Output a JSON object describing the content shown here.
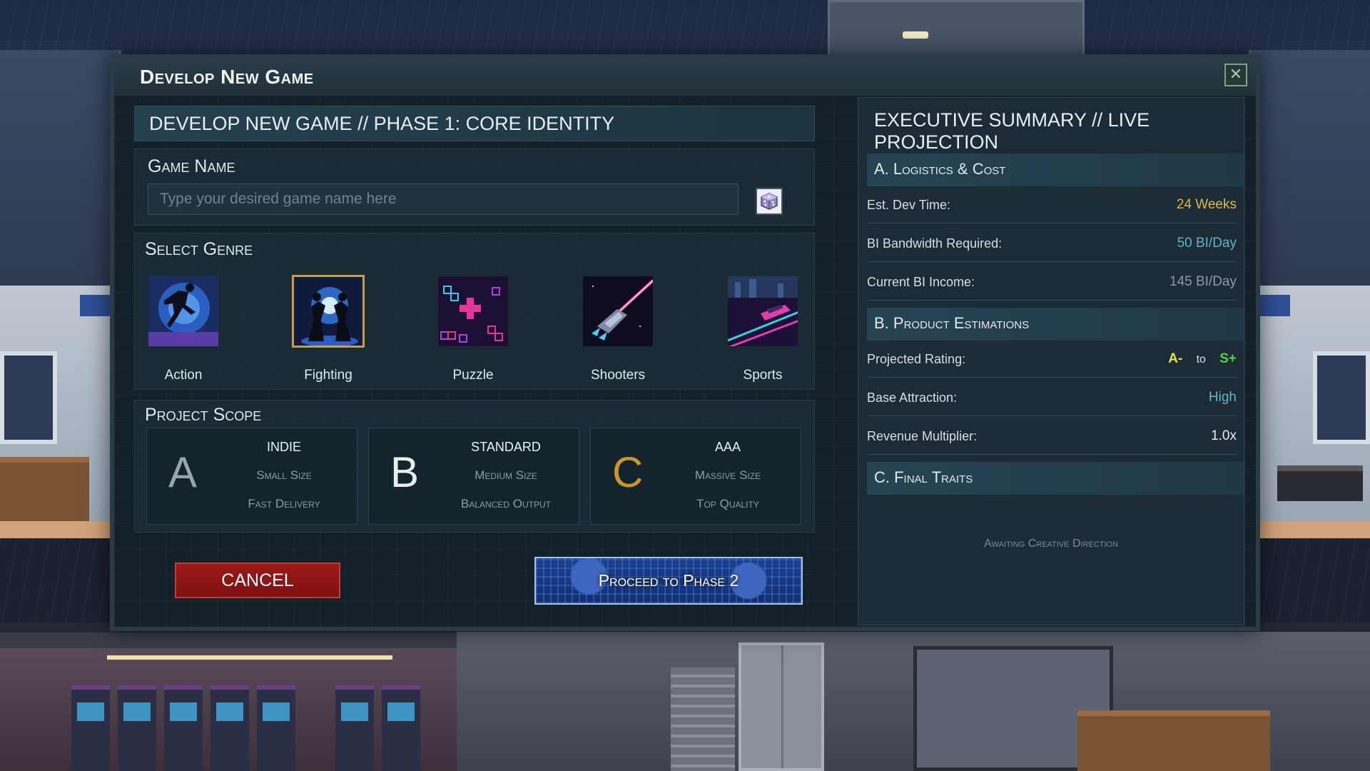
{
  "dialog": {
    "title": "Develop New Game",
    "close_icon": "close-icon"
  },
  "phase_header": "DEVELOP NEW GAME // PHASE 1: CORE IDENTITY",
  "game_name": {
    "label": "Game Name",
    "placeholder": "Type your desired game name here",
    "value": "",
    "random_icon": "dice-icon"
  },
  "genre": {
    "label": "Select Genre",
    "selected": "Fighting",
    "items": [
      {
        "label": "Action",
        "icon": "action-genre-art"
      },
      {
        "label": "Fighting",
        "icon": "fighting-genre-art"
      },
      {
        "label": "Puzzle",
        "icon": "puzzle-genre-art"
      },
      {
        "label": "Shooters",
        "icon": "shooters-genre-art"
      },
      {
        "label": "Sports",
        "icon": "sports-genre-art"
      }
    ]
  },
  "scope": {
    "label": "Project Scope",
    "options": [
      {
        "letter": "A",
        "title": "INDIE",
        "line1": "Small Size",
        "line2": "Fast Delivery",
        "letter_color": "#9aa4ab"
      },
      {
        "letter": "B",
        "title": "STANDARD",
        "line1": "Medium Size",
        "line2": "Balanced Output",
        "letter_color": "#e8ecef"
      },
      {
        "letter": "C",
        "title": "AAA",
        "line1": "Massive Size",
        "line2": "Top Quality",
        "letter_color": "#c9962e"
      }
    ]
  },
  "buttons": {
    "cancel": "CANCEL",
    "proceed": "Proceed to Phase 2"
  },
  "summary": {
    "title": "EXECUTIVE SUMMARY // LIVE PROJECTION",
    "logistics": {
      "header": "A. Logistics & Cost",
      "rows": [
        {
          "key": "Est. Dev Time:",
          "value": "24 Weeks",
          "color": "#e0b84a"
        },
        {
          "key": "BI Bandwidth Required:",
          "value": "50 BI/Day",
          "color": "#5fb6c6"
        },
        {
          "key": "Current BI Income:",
          "value": "145 BI/Day",
          "color": "#8f9aa2"
        }
      ]
    },
    "estimations": {
      "header": "B. Product Estimations",
      "rating_key": "Projected Rating:",
      "rating_low": "A-",
      "rating_to": "to",
      "rating_high": "S+",
      "rating_low_color": "#e6e04a",
      "rating_high_color": "#4ad64a",
      "rows": [
        {
          "key": "Base Attraction:",
          "value": "High",
          "color": "#5fb6c6"
        },
        {
          "key": "Revenue Multiplier:",
          "value": "1.0x",
          "color": "#e8ecef"
        }
      ]
    },
    "traits": {
      "header": "C. Final Traits",
      "empty": "Awaiting Creative Direction"
    }
  }
}
